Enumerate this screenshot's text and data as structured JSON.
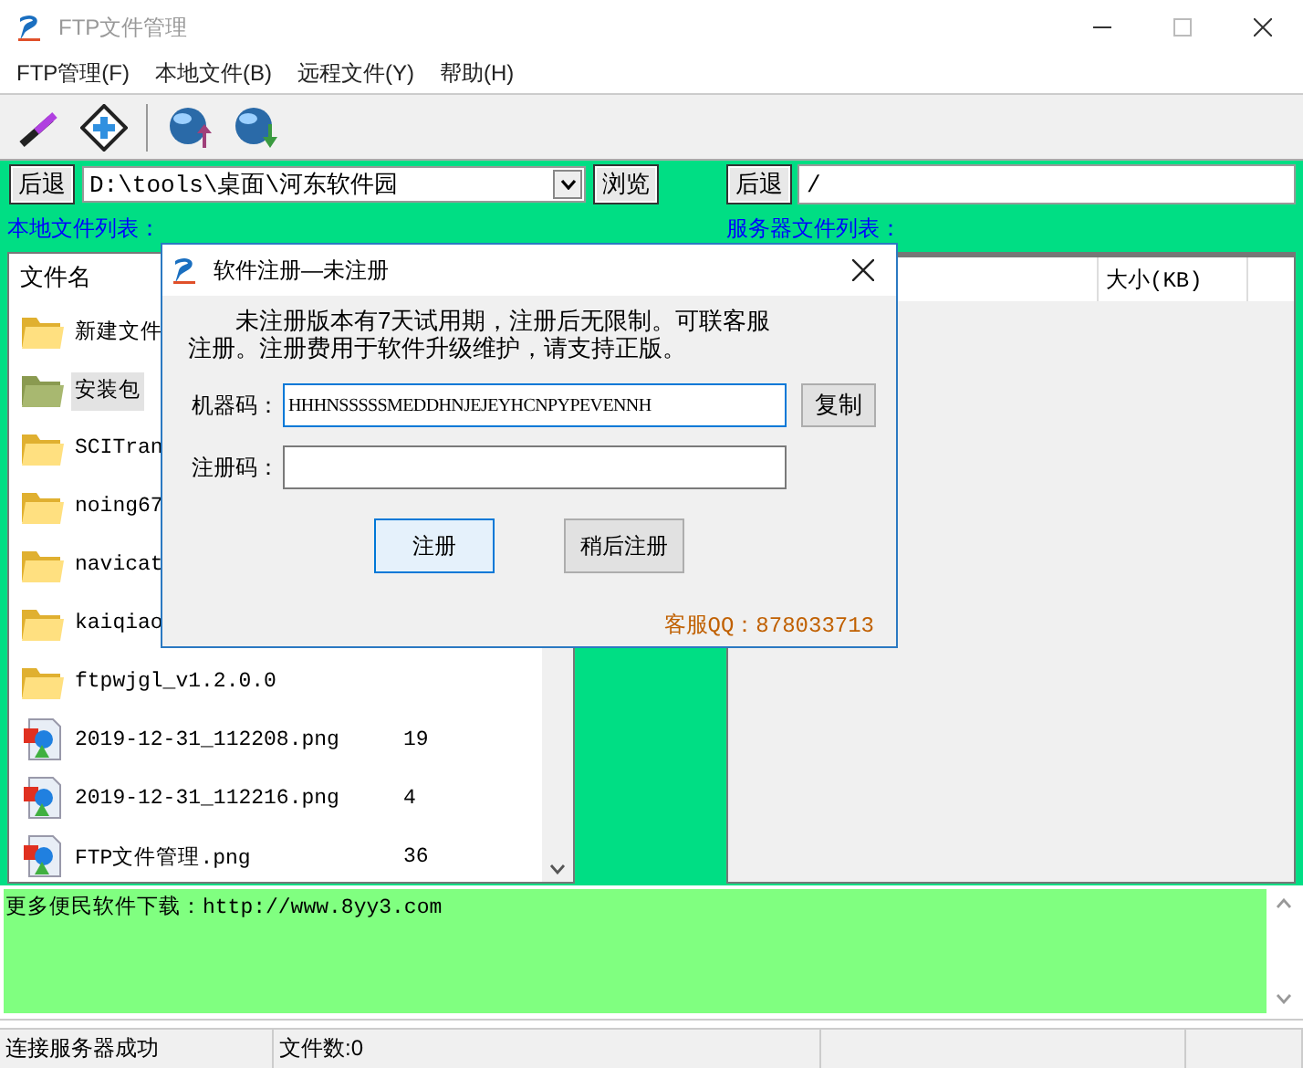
{
  "window": {
    "title": "FTP文件管理"
  },
  "menu": [
    "FTP管理(F)",
    "本地文件(B)",
    "远程文件(Y)",
    "帮助(H)"
  ],
  "toolbar": [
    {
      "kind": "wand"
    },
    {
      "kind": "diamond"
    },
    {
      "kind": "upload"
    },
    {
      "kind": "download"
    }
  ],
  "local": {
    "back": "后退",
    "path": "D:\\tools\\桌面\\河东软件园",
    "browse": "浏览",
    "label": "本地文件列表：",
    "column": "文件名",
    "rows": [
      {
        "kind": "folder",
        "name": "新建文件",
        "selected": false
      },
      {
        "kind": "folder",
        "name": "安装包",
        "selected": true
      },
      {
        "kind": "folder",
        "name": "SCITran",
        "selected": false
      },
      {
        "kind": "folder",
        "name": "noing67",
        "selected": false
      },
      {
        "kind": "folder",
        "name": "navicat",
        "selected": false
      },
      {
        "kind": "folder",
        "name": "kaiqiao",
        "selected": false
      },
      {
        "kind": "folder",
        "name": "ftpwjgl_v1.2.0.0",
        "selected": false
      },
      {
        "kind": "image",
        "name": "2019-12-31_112208.png",
        "size": "19",
        "selected": false
      },
      {
        "kind": "image",
        "name": "2019-12-31_112216.png",
        "size": "4",
        "selected": false
      },
      {
        "kind": "image",
        "name": "FTP文件管理.png",
        "size": "36",
        "selected": false
      }
    ]
  },
  "remote": {
    "back": "后退",
    "path": "/",
    "label": "服务器文件列表：",
    "column": "大小(KB)"
  },
  "log": "更多便民软件下载：http://www.8yy3.com",
  "status_bar": [
    "连接服务器成功",
    "文件数:0"
  ],
  "dialog": {
    "title": "软件注册—未注册",
    "message": "未注册版本有7天试用期，注册后无限制。可联客服注册。注册费用于软件升级维护，请支持正版。",
    "machine_label": "机器码：",
    "machine_code": "HHHNSSSSSMEDDHNJEJEYHCNPYPEVENNH",
    "copy": "复制",
    "reg_label": "注册码：",
    "buttons": [
      {
        "label": "注册",
        "selected": true
      },
      {
        "label": "稍后注册",
        "selected": false
      }
    ],
    "contact": "客服QQ：878033713"
  }
}
